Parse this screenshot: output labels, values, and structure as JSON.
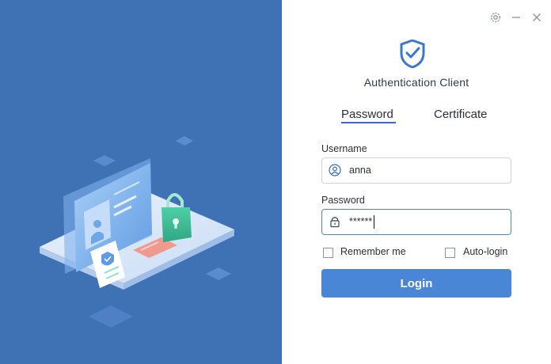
{
  "window": {
    "controls": {
      "settings_icon": "gear-icon",
      "minimize_icon": "minimize-icon",
      "close_icon": "close-icon"
    }
  },
  "app": {
    "title": "Authentication Client",
    "logo_icon": "shield-check-icon"
  },
  "tabs": [
    {
      "label": "Password",
      "active": true
    },
    {
      "label": "Certificate",
      "active": false
    }
  ],
  "form": {
    "username": {
      "label": "Username",
      "value": "anna",
      "icon": "user-icon"
    },
    "password": {
      "label": "Password",
      "value": "******",
      "icon": "lock-icon",
      "focused": true
    },
    "remember_me": {
      "label": "Remember me",
      "checked": false
    },
    "auto_login": {
      "label": "Auto-login",
      "checked": false
    },
    "login_button": "Login"
  },
  "colors": {
    "panel_blue": "#3f72b5",
    "accent": "#4a86d6",
    "tab_underline": "#3a6db8",
    "logo": "#3a78cf"
  }
}
